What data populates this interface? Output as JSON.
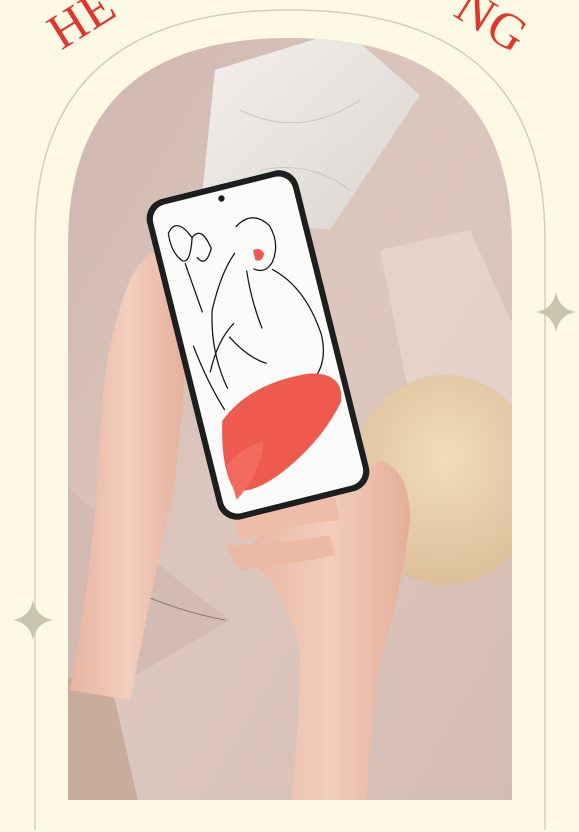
{
  "header": {
    "title_left": "HE",
    "title_right": "NG"
  },
  "colors": {
    "background": "#fdf9e4",
    "arch_line": "#d6cfb4",
    "title": "#e0372c",
    "accent_red": "#ee5a4d",
    "photo_wall": "#d8c2ba",
    "skin": "#f0c5b2"
  },
  "icons": [
    "sparkle-star-icon",
    "sparkle-star-icon"
  ]
}
